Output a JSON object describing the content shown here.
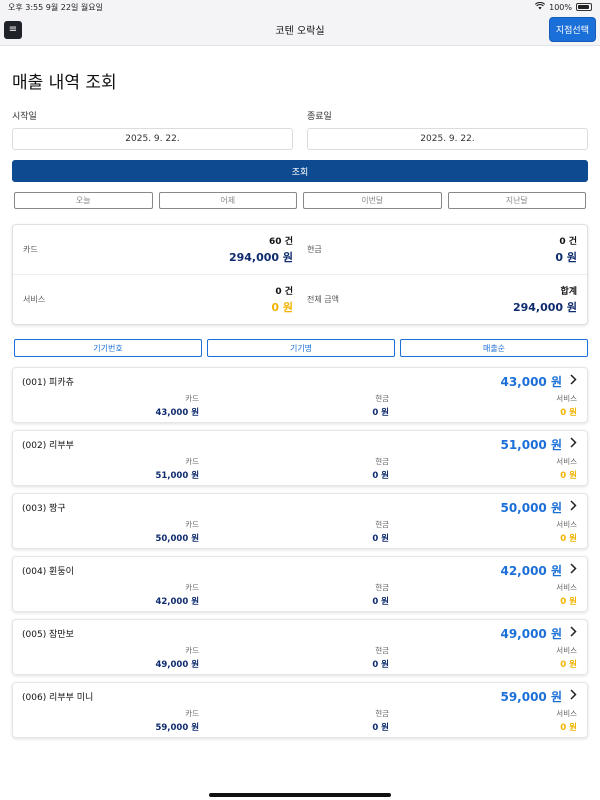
{
  "status": {
    "time": "오후 3:55",
    "date": "9월 22일 월요일",
    "battery": "100%"
  },
  "nav": {
    "menu_icon": "≡",
    "title": "코텐 오락실",
    "branch_button": "지점선택"
  },
  "page_title": "매출 내역 조회",
  "date_range": {
    "start_label": "시작일",
    "start_value": "2025. 9. 22.",
    "end_label": "종료일",
    "end_value": "2025. 9. 22."
  },
  "search_button": "조회",
  "quick_filters": [
    "오늘",
    "어제",
    "이번달",
    "지난달"
  ],
  "summary": {
    "card": {
      "label": "카드",
      "count": "60 건",
      "amount": "294,000 원"
    },
    "cash": {
      "label": "현금",
      "count": "0 건",
      "amount": "0 원"
    },
    "service": {
      "label": "서비스",
      "count": "0 건",
      "amount": "0 원"
    },
    "total": {
      "label": "전체 금액",
      "count": "합계",
      "amount": "294,000 원"
    }
  },
  "sort_buttons": [
    "기기번호",
    "기기명",
    "매출순"
  ],
  "column_labels": {
    "card": "카드",
    "cash": "현금",
    "service": "서비스"
  },
  "machines": [
    {
      "name": "(001) 피카츄",
      "total": "43,000 원",
      "card": "43,000 원",
      "cash": "0 원",
      "service": "0 원"
    },
    {
      "name": "(002) 리부부",
      "total": "51,000 원",
      "card": "51,000 원",
      "cash": "0 원",
      "service": "0 원"
    },
    {
      "name": "(003) 짱구",
      "total": "50,000 원",
      "card": "50,000 원",
      "cash": "0 원",
      "service": "0 원"
    },
    {
      "name": "(004) 휜둥이",
      "total": "42,000 원",
      "card": "42,000 원",
      "cash": "0 원",
      "service": "0 원"
    },
    {
      "name": "(005) 잠만보",
      "total": "49,000 원",
      "card": "49,000 원",
      "cash": "0 원",
      "service": "0 원"
    },
    {
      "name": "(006) 리부부 미니",
      "total": "59,000 원",
      "card": "59,000 원",
      "cash": "0 원",
      "service": "0 원"
    }
  ],
  "colors": {
    "primary_blue": "#1b6fd8",
    "navy": "#0e4a8f",
    "amount_navy": "#0e2b6e",
    "service_gold": "#f1b400"
  }
}
